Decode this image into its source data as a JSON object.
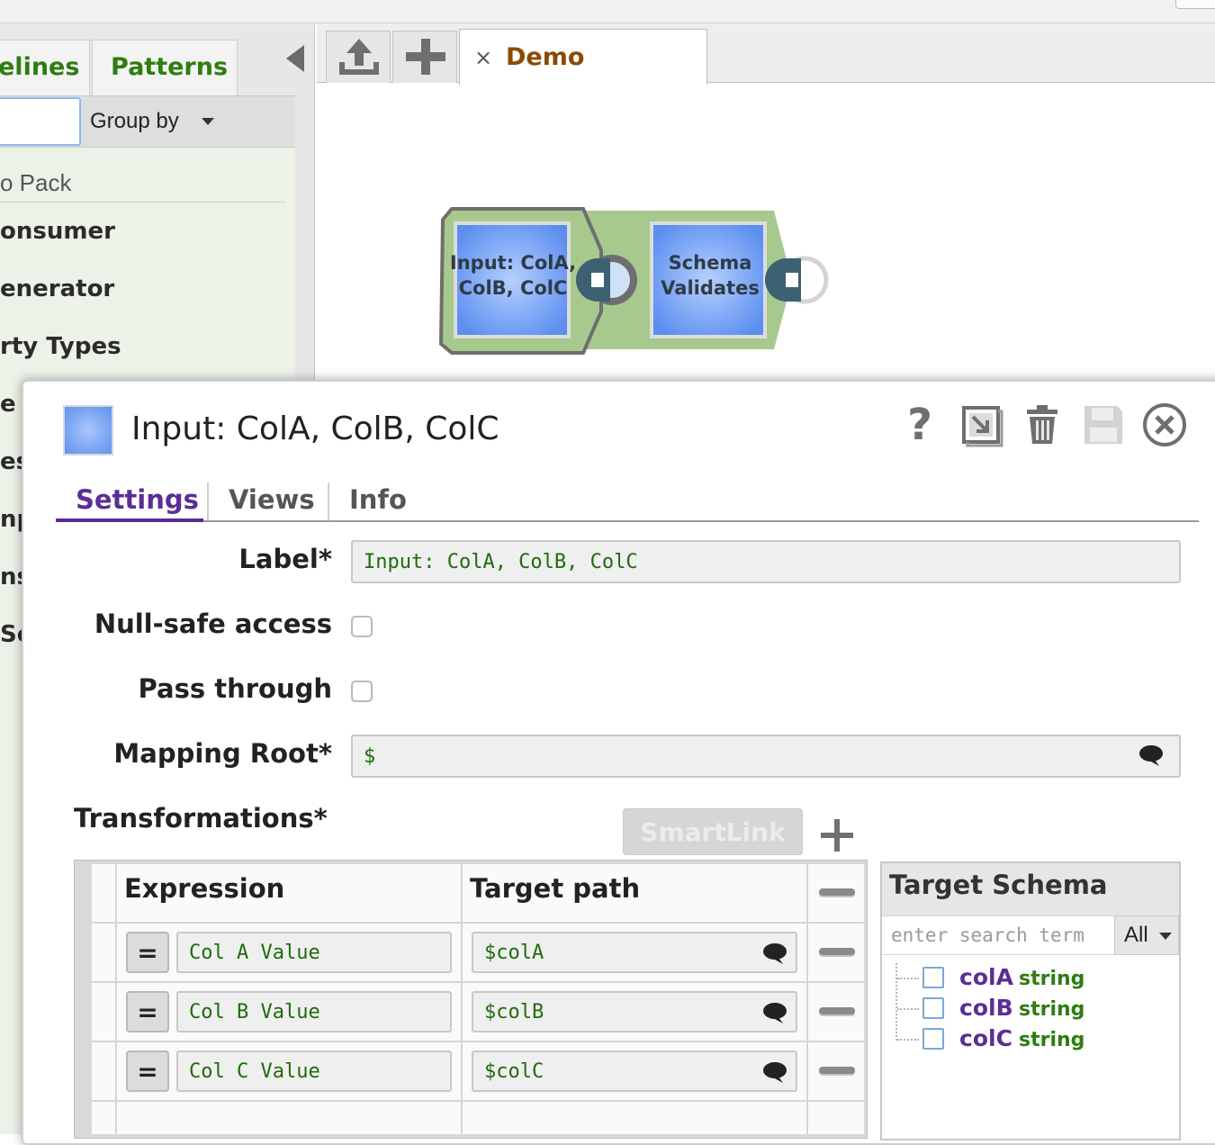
{
  "sidebar": {
    "tabs": [
      "elines",
      "Patterns"
    ],
    "group_by_label": "Group by",
    "pack_label": "o Pack",
    "items": [
      "onsumer",
      "enerator",
      "rty Types",
      "e D",
      "est",
      "np",
      "ns",
      "Sc"
    ]
  },
  "canvas": {
    "tab_label": "Demo",
    "tab_close": "×",
    "snaps": [
      {
        "line1": "Input: ColA,",
        "line2": "ColB, ColC"
      },
      {
        "line1": "Schema",
        "line2": "Validates"
      }
    ]
  },
  "dialog": {
    "title": "Input: ColA, ColB, ColC",
    "help_glyph": "?",
    "tabs": [
      "Settings",
      "Views",
      "Info"
    ],
    "fields": {
      "label_label": "Label*",
      "label_value": "Input: ColA, ColB, ColC",
      "null_safe_label": "Null-safe access",
      "null_safe_checked": false,
      "pass_through_label": "Pass through",
      "pass_through_checked": false,
      "mapping_root_label": "Mapping Root*",
      "mapping_root_value": "$"
    },
    "transformations_label": "Transformations*",
    "smartlink_label": "SmartLink",
    "table": {
      "headers": [
        "Expression",
        "Target path"
      ],
      "eq_symbol": "=",
      "rows": [
        {
          "expression": "Col A Value",
          "target": "$colA"
        },
        {
          "expression": "Col B Value",
          "target": "$colB"
        },
        {
          "expression": "Col C Value",
          "target": "$colC"
        }
      ]
    },
    "target_schema": {
      "title": "Target Schema",
      "search_placeholder": "enter search term",
      "filter_value": "All",
      "items": [
        {
          "name": "colA",
          "type": "string"
        },
        {
          "name": "colB",
          "type": "string"
        },
        {
          "name": "colC",
          "type": "string"
        }
      ]
    }
  },
  "colors": {
    "accent_purple": "#5b2d95",
    "label_green": "#2e7d10",
    "demo_brown": "#8a4b00",
    "snap_blue": "#5f92ee",
    "pipeline_green": "#a8c98e"
  }
}
